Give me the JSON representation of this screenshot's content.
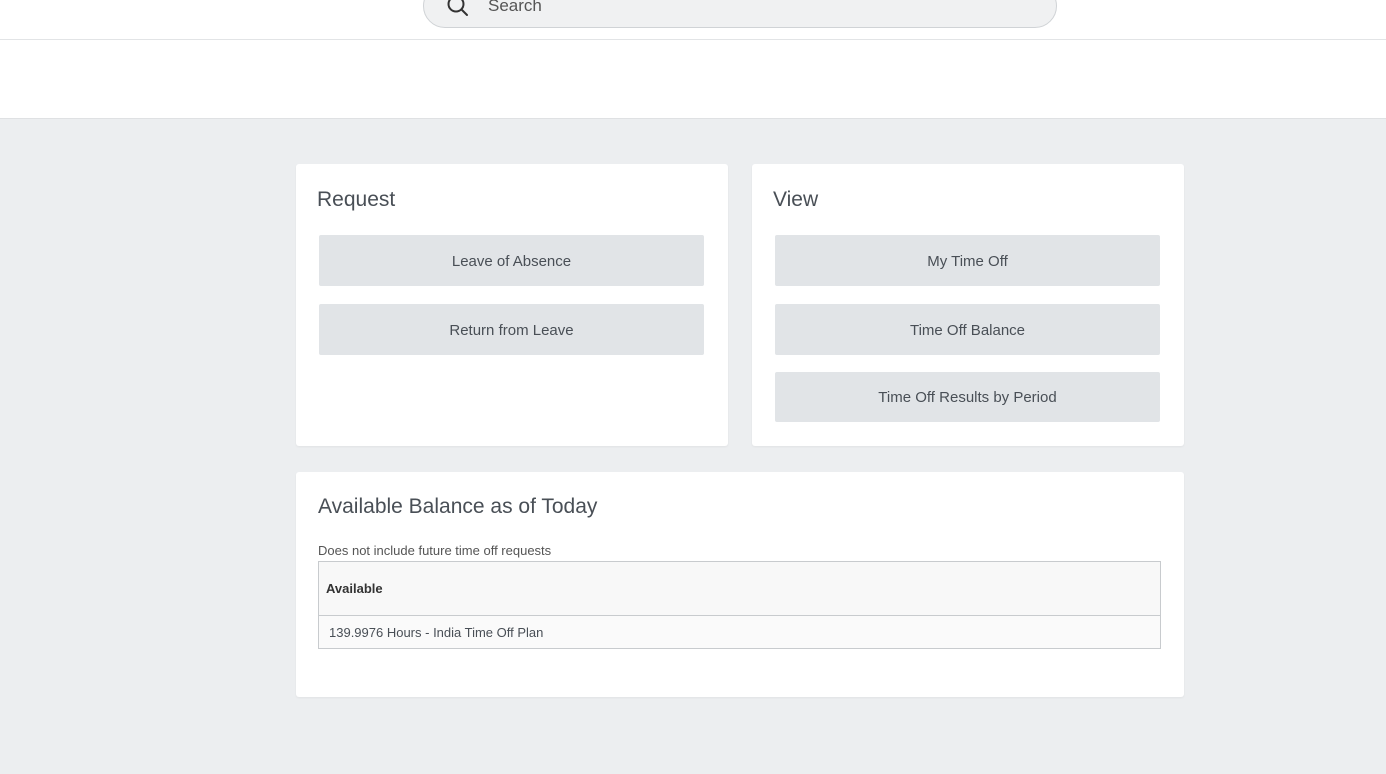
{
  "search": {
    "placeholder": "Search"
  },
  "request": {
    "title": "Request",
    "buttons": [
      "Leave of Absence",
      "Return from Leave"
    ]
  },
  "view": {
    "title": "View",
    "buttons": [
      "My Time Off",
      "Time Off Balance",
      "Time Off Results by Period"
    ]
  },
  "balance": {
    "title": "Available Balance as of Today",
    "note": "Does not include future time off requests",
    "table": {
      "header": "Available",
      "rows": [
        "139.9976 Hours - India Time Off Plan"
      ]
    }
  }
}
